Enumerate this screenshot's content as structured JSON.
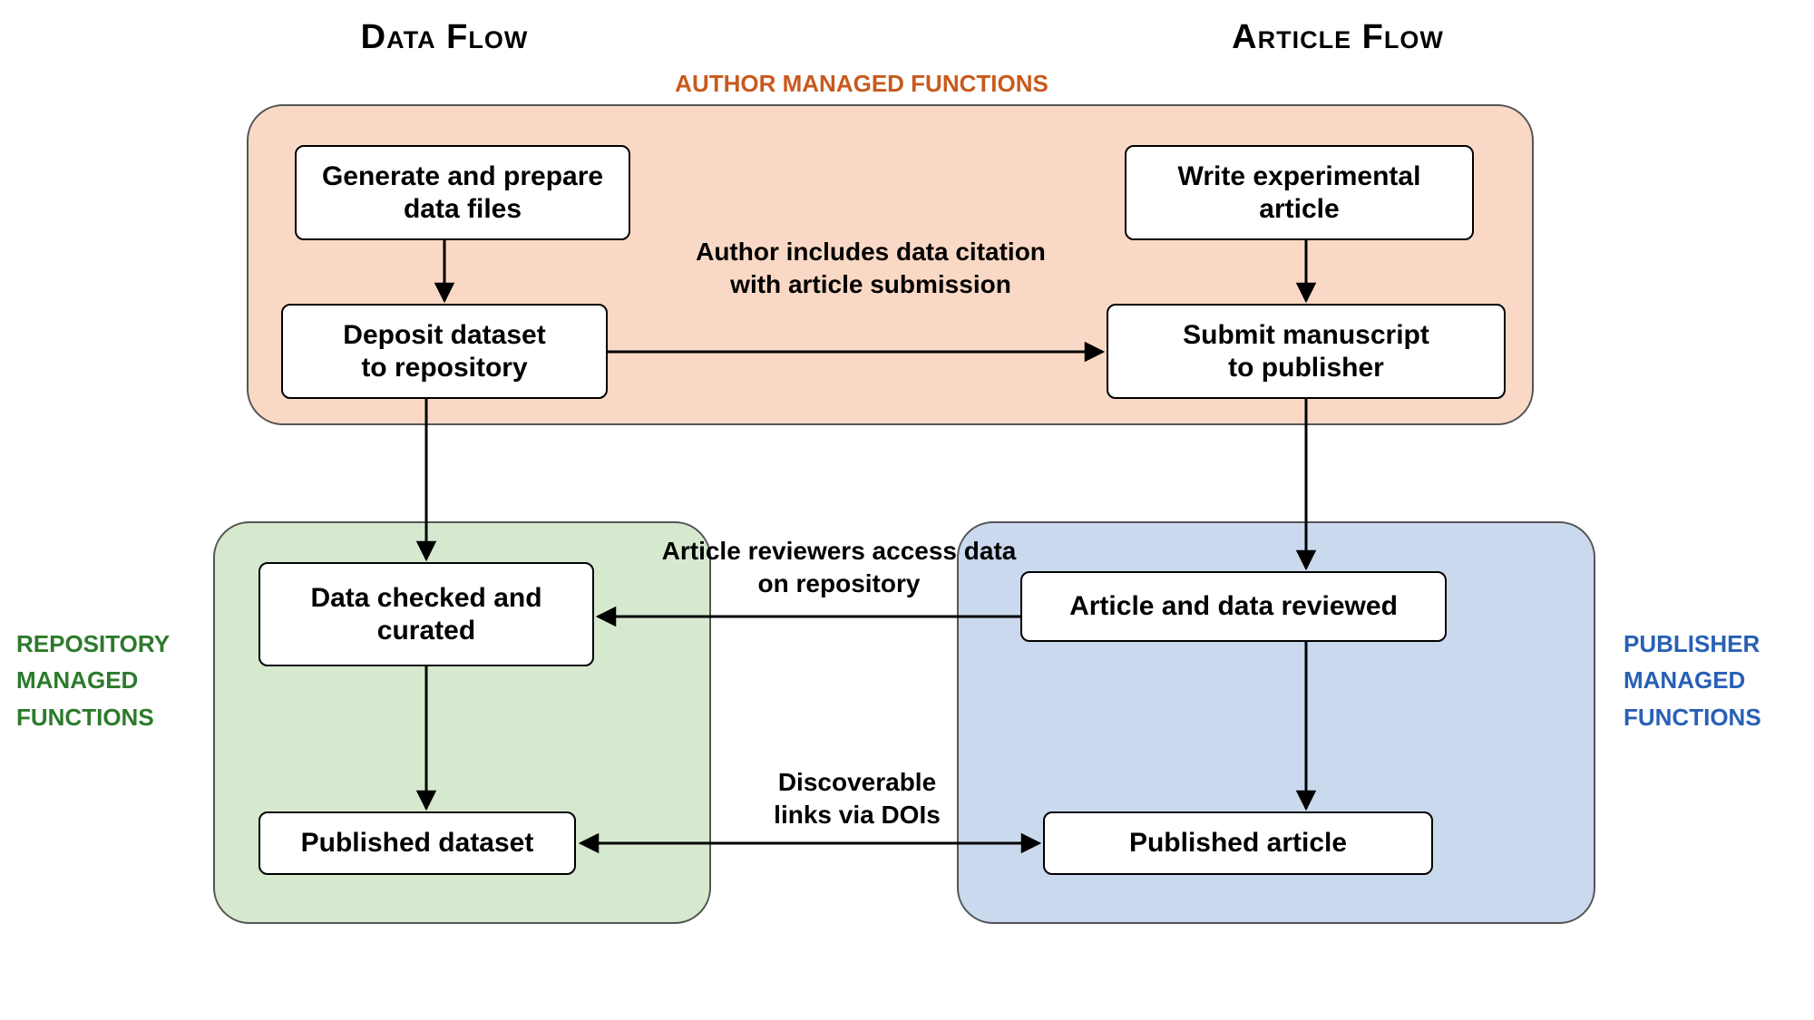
{
  "headings": {
    "data_flow": "Data Flow",
    "article_flow": "Article Flow"
  },
  "groups": {
    "author": "AUTHOR MANAGED FUNCTIONS",
    "repository": "REPOSITORY\nMANAGED\nFUNCTIONS",
    "publisher": "PUBLISHER\nMANAGED\nFUNCTIONS"
  },
  "boxes": {
    "generate": "Generate and prepare\ndata files",
    "deposit": "Deposit dataset\nto repository",
    "write": "Write experimental\narticle",
    "submit": "Submit manuscript\nto publisher",
    "checked": "Data checked and\ncurated",
    "pub_dataset": "Published dataset",
    "reviewed": "Article and data reviewed",
    "pub_article": "Published article"
  },
  "connectors": {
    "cite": "Author includes data citation\nwith article submission",
    "reviewers": "Article reviewers access data\non repository",
    "dois": "Discoverable\nlinks via DOIs"
  }
}
